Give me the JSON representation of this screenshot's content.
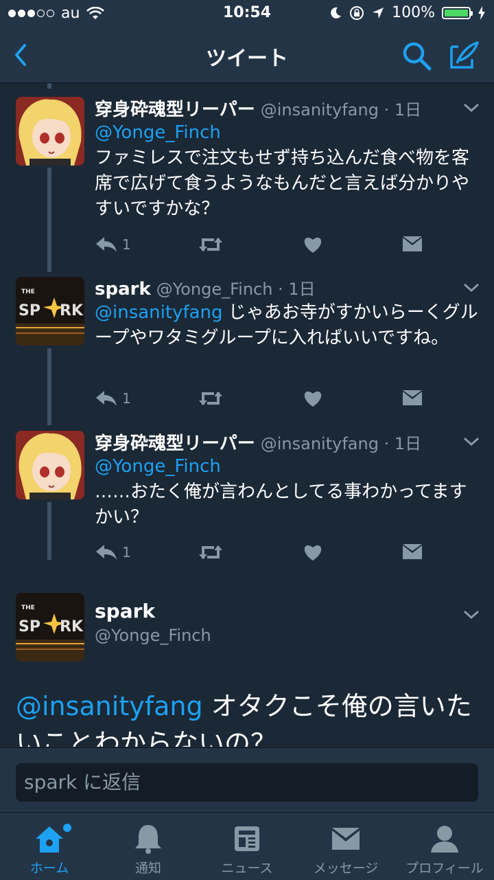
{
  "status": {
    "carrier": "au",
    "time": "10:54",
    "battery": "100%"
  },
  "nav": {
    "title": "ツイート"
  },
  "tweets": [
    {
      "name": "穿身砕魂型リーパー",
      "handle": "@insanityfang · 1日",
      "mention": "@Yonge_Finch",
      "text": "ファミレスで注文もせず持ち込んだ食べ物を客席で広げて食うようなもんだと言えば分かりやすいですかな？",
      "reply_count": "1"
    },
    {
      "name": "spark",
      "handle": "@Yonge_Finch · 1日",
      "mention": "@insanityfang",
      "text": " じゃあお寺がすかいらーくグループやワタミグループに入ればいいですね。",
      "reply_count": "1"
    },
    {
      "name": "穿身砕魂型リーパー",
      "handle": "@insanityfang · 1日",
      "mention": "@Yonge_Finch",
      "text": "……おたく俺が言わんとしてる事わかってますかい？",
      "reply_count": "1"
    }
  ],
  "focus": {
    "name": "spark",
    "handle": "@Yonge_Finch",
    "mention": "@insanityfang",
    "text": " オタクこそ俺の言いたいことわからないの？"
  },
  "reply": {
    "placeholder": "spark に返信"
  },
  "tabs": [
    {
      "label": "ホーム",
      "icon": "home-icon"
    },
    {
      "label": "通知",
      "icon": "bell-icon"
    },
    {
      "label": "ニュース",
      "icon": "news-icon"
    },
    {
      "label": "メッセージ",
      "icon": "envelope-icon"
    },
    {
      "label": "プロフィール",
      "icon": "person-icon"
    }
  ],
  "colors": {
    "accent": "#1da1f2",
    "background": "#1b2836",
    "bar": "#243447",
    "secondary": "#8899a6"
  }
}
